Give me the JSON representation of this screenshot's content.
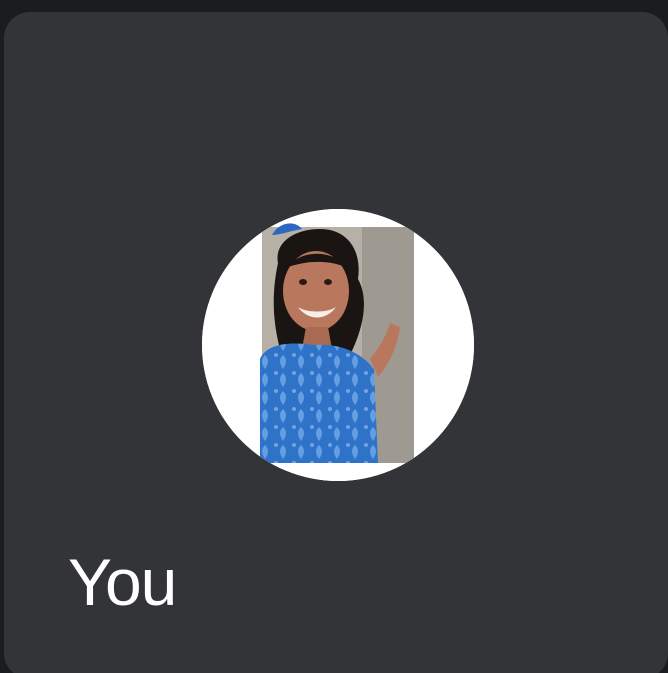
{
  "tile": {
    "participant_name": "You",
    "avatar_icon": "participant-photo-icon"
  },
  "colors": {
    "page_background": "#1b1c1f",
    "tile_background": "#333438",
    "name_text": "#ffffff",
    "avatar_ring": "#ffffff"
  }
}
